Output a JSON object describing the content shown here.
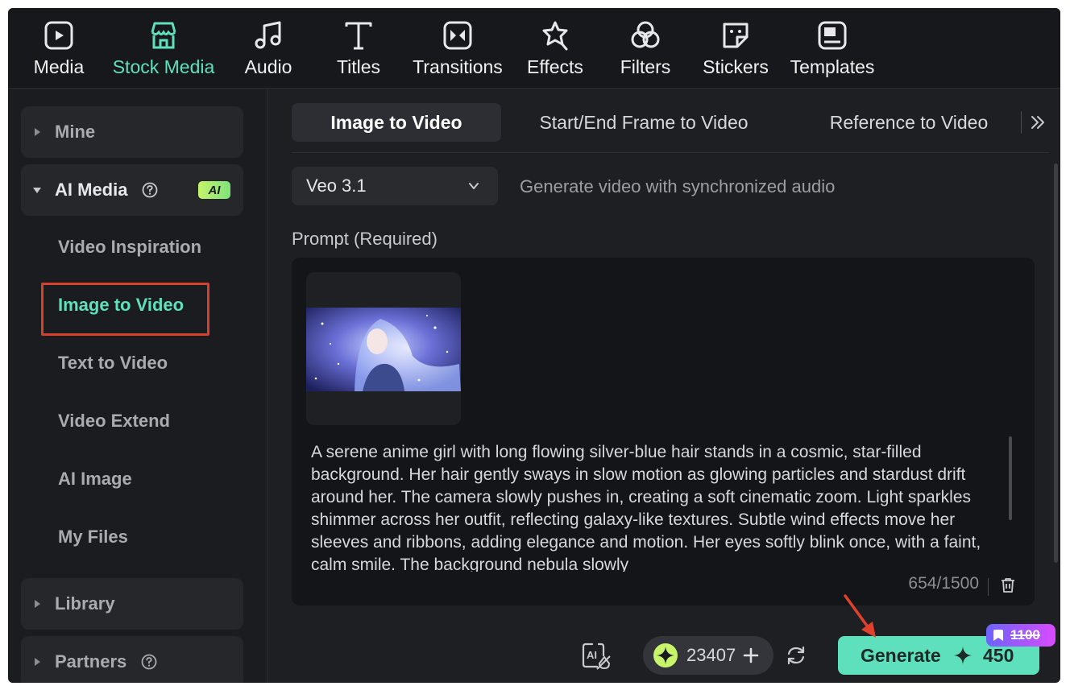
{
  "toolbar": {
    "items": [
      {
        "label": "Media",
        "icon": "media-icon"
      },
      {
        "label": "Stock Media",
        "icon": "store-icon",
        "active": true
      },
      {
        "label": "Audio",
        "icon": "music-note-icon"
      },
      {
        "label": "Titles",
        "icon": "text-t-icon"
      },
      {
        "label": "Transitions",
        "icon": "transition-icon"
      },
      {
        "label": "Effects",
        "icon": "star-effects-icon"
      },
      {
        "label": "Filters",
        "icon": "filters-icon"
      },
      {
        "label": "Stickers",
        "icon": "sticker-icon"
      },
      {
        "label": "Templates",
        "icon": "template-icon"
      }
    ]
  },
  "sidebar": {
    "mine": "Mine",
    "ai_media": "AI Media",
    "ai_badge": "AI",
    "items": [
      {
        "label": "Video Inspiration"
      },
      {
        "label": "Image to Video",
        "active": true
      },
      {
        "label": "Text to Video"
      },
      {
        "label": "Video Extend"
      },
      {
        "label": "AI Image"
      },
      {
        "label": "My Files"
      }
    ],
    "library": "Library",
    "partners": "Partners"
  },
  "main": {
    "tabs": [
      {
        "label": "Image to Video",
        "active": true
      },
      {
        "label": "Start/End Frame to Video"
      },
      {
        "label": "Reference to Video"
      }
    ],
    "model": {
      "selected": "Veo 3.1",
      "description": "Generate video with synchronized audio"
    },
    "prompt": {
      "label": "Prompt (Required)",
      "text": "A serene anime girl with long flowing silver-blue hair stands in a cosmic, star-filled background. Her hair gently sways in slow motion as glowing particles and stardust drift around her. The camera slowly pushes in, creating a soft cinematic zoom. Light sparkles shimmer across her outfit, reflecting galaxy-like textures. Subtle wind effects move her sleeves and ribbons, adding elegance and motion. Her eyes softly blink once, with a faint, calm smile. The background nebula slowly",
      "char_count": "654/1500"
    },
    "credits": "23407",
    "generate": {
      "label": "Generate",
      "cost": "450",
      "original_cost": "1100"
    }
  },
  "colors": {
    "accent": "#5fe0bd",
    "highlight_box": "#d8402e",
    "background": "#1e1f22"
  }
}
